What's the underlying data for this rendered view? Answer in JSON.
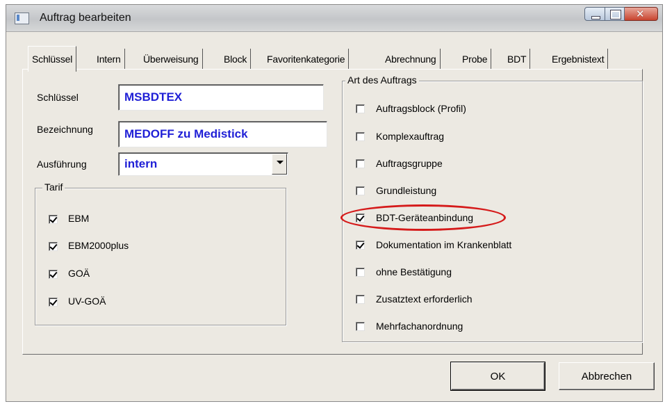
{
  "window": {
    "title": "Auftrag bearbeiten"
  },
  "tabs": [
    "Schlüssel",
    "Intern",
    "Überweisung",
    "Block",
    "Favoritenkategorie",
    "Abrechnung",
    "Probe",
    "BDT",
    "Ergebnistext"
  ],
  "active_tab": "Schlüssel",
  "form": {
    "schluessel_label": "Schlüssel",
    "schluessel_value": "MSBDTEX",
    "bezeichnung_label": "Bezeichnung",
    "bezeichnung_value": "MEDOFF zu Medistick",
    "ausfuehrung_label": "Ausführung",
    "ausfuehrung_value": "intern"
  },
  "tarif": {
    "title": "Tarif",
    "items": [
      {
        "label": "EBM",
        "checked": true
      },
      {
        "label": "EBM2000plus",
        "checked": true
      },
      {
        "label": "GOÄ",
        "checked": true
      },
      {
        "label": "UV-GOÄ",
        "checked": true
      }
    ]
  },
  "art": {
    "title": "Art des Auftrags",
    "items": [
      {
        "label": "Auftragsblock (Profil)",
        "checked": false
      },
      {
        "label": "Komplexauftrag",
        "checked": false
      },
      {
        "label": "Auftragsgruppe",
        "checked": false
      },
      {
        "label": "Grundleistung",
        "checked": false
      },
      {
        "label": "BDT-Geräteanbindung",
        "checked": true,
        "highlighted": true
      },
      {
        "label": "Dokumentation im Krankenblatt",
        "checked": true
      },
      {
        "label": "ohne Bestätigung",
        "checked": false
      },
      {
        "label": "Zusatztext erforderlich",
        "checked": false
      },
      {
        "label": "Mehrfachanordnung",
        "checked": false
      }
    ]
  },
  "buttons": {
    "ok": "OK",
    "cancel": "Abbrechen"
  },
  "colors": {
    "field_text": "#1f1fd6",
    "highlight": "#d51a1a",
    "dialog_bg": "#ece9e2"
  }
}
